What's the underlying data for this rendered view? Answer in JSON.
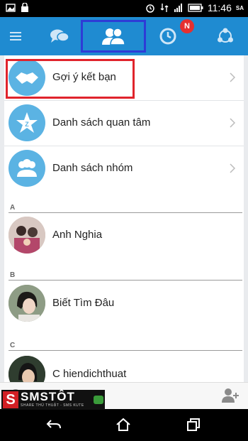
{
  "status_bar": {
    "time": "11:46",
    "carrier": "SA",
    "icons": [
      "image-icon",
      "lock-icon",
      "alarm-icon",
      "data-icon",
      "signal-icon",
      "battery-icon"
    ]
  },
  "tabs": [
    {
      "name": "menu",
      "icon": "menu-icon"
    },
    {
      "name": "messages",
      "icon": "chat-icon"
    },
    {
      "name": "contacts",
      "icon": "contacts-icon",
      "active": true
    },
    {
      "name": "timeline",
      "icon": "clock-icon",
      "badge": "N"
    },
    {
      "name": "more",
      "icon": "share-icon"
    }
  ],
  "quick_items": [
    {
      "label": "Gợi ý kết bạn",
      "icon": "handshake-icon"
    },
    {
      "label": "Danh sách quan tâm",
      "icon": "star-icon"
    },
    {
      "label": "Danh sách nhóm",
      "icon": "group-icon"
    }
  ],
  "sections": [
    {
      "letter": "A",
      "contacts": [
        {
          "name": "Anh Nghia"
        }
      ]
    },
    {
      "letter": "B",
      "contacts": [
        {
          "name": "Biết Tìm Đâu"
        }
      ]
    },
    {
      "letter": "C",
      "contacts": [
        {
          "name": "C hiendichthuat"
        }
      ]
    }
  ],
  "watermark": {
    "brand": "SMSTÔT",
    "tagline": "SHARE THỦ THUẬT - SMS KUTE",
    "mark": "S"
  },
  "colors": {
    "accent": "#1f8bd1",
    "highlight_red": "#e0242c",
    "highlight_blue": "#2e3bd6",
    "badge": "#e53030"
  }
}
